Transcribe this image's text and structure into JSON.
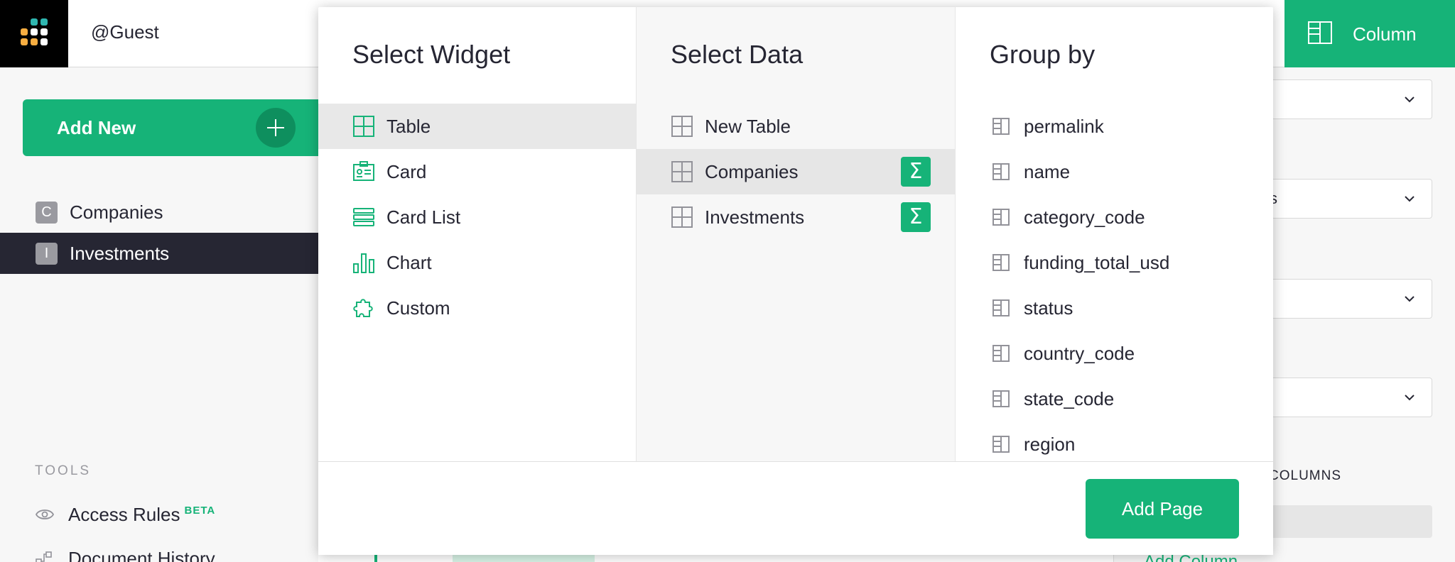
{
  "header": {
    "user": "@Guest"
  },
  "left_panel": {
    "add_new_label": "Add New",
    "pages": [
      {
        "initial": "C",
        "label": "Companies"
      },
      {
        "initial": "I",
        "label": "Investments"
      }
    ],
    "tools_title": "TOOLS",
    "tools": [
      {
        "label": "Access Rules",
        "badge": "BETA",
        "icon": "eye-icon"
      },
      {
        "label": "Document History",
        "icon": "history-icon"
      }
    ]
  },
  "right_panel": {
    "tab_label": "Column",
    "partial_text": "s",
    "section_label": "COLUMNS",
    "add_column_label": "Add Column"
  },
  "modal": {
    "widget_title": "Select Widget",
    "widgets": [
      {
        "label": "Table",
        "icon": "table-icon"
      },
      {
        "label": "Card",
        "icon": "card-icon"
      },
      {
        "label": "Card List",
        "icon": "card-list-icon"
      },
      {
        "label": "Chart",
        "icon": "chart-icon"
      },
      {
        "label": "Custom",
        "icon": "puzzle-icon"
      }
    ],
    "selected_widget": "Table",
    "data_title": "Select Data",
    "data_items": [
      {
        "label": "New Table",
        "summary": ""
      },
      {
        "label": "Companies",
        "summary": "Σ"
      },
      {
        "label": "Investments",
        "summary": "Σ"
      }
    ],
    "selected_data": "Companies",
    "group_title": "Group by",
    "group_fields": [
      "permalink",
      "name",
      "category_code",
      "funding_total_usd",
      "status",
      "country_code",
      "state_code",
      "region"
    ],
    "add_page_label": "Add Page"
  },
  "colors": {
    "accent": "#16b378",
    "dark": "#262633",
    "panel": "#f7f7f7"
  }
}
